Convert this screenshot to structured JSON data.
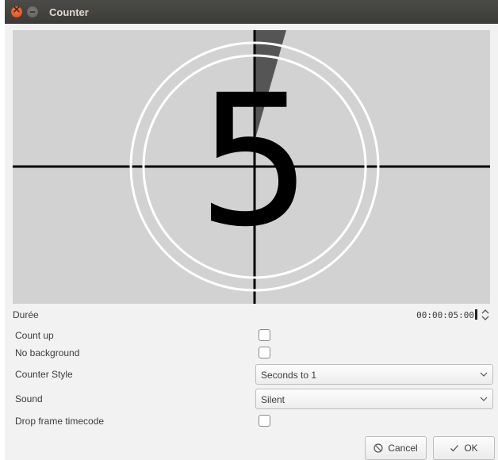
{
  "window": {
    "title": "Counter"
  },
  "preview": {
    "number": "5"
  },
  "duration": {
    "label": "Durée",
    "value": "00:00:05:00"
  },
  "options": {
    "count_up": {
      "label": "Count up",
      "checked": false
    },
    "no_background": {
      "label": "No background",
      "checked": false
    },
    "counter_style": {
      "label": "Counter Style",
      "value": "Seconds to 1"
    },
    "sound": {
      "label": "Sound",
      "value": "Silent"
    },
    "drop_frame": {
      "label": "Drop frame timecode",
      "checked": false
    }
  },
  "buttons": {
    "cancel": "Cancel",
    "ok": "OK"
  },
  "icons": {
    "close": "close-icon",
    "minimize": "minimize-icon",
    "cancel": "cancel-icon",
    "ok": "check-icon",
    "spin": "spin-arrows-icon",
    "dropdown": "chevron-down-icon"
  }
}
